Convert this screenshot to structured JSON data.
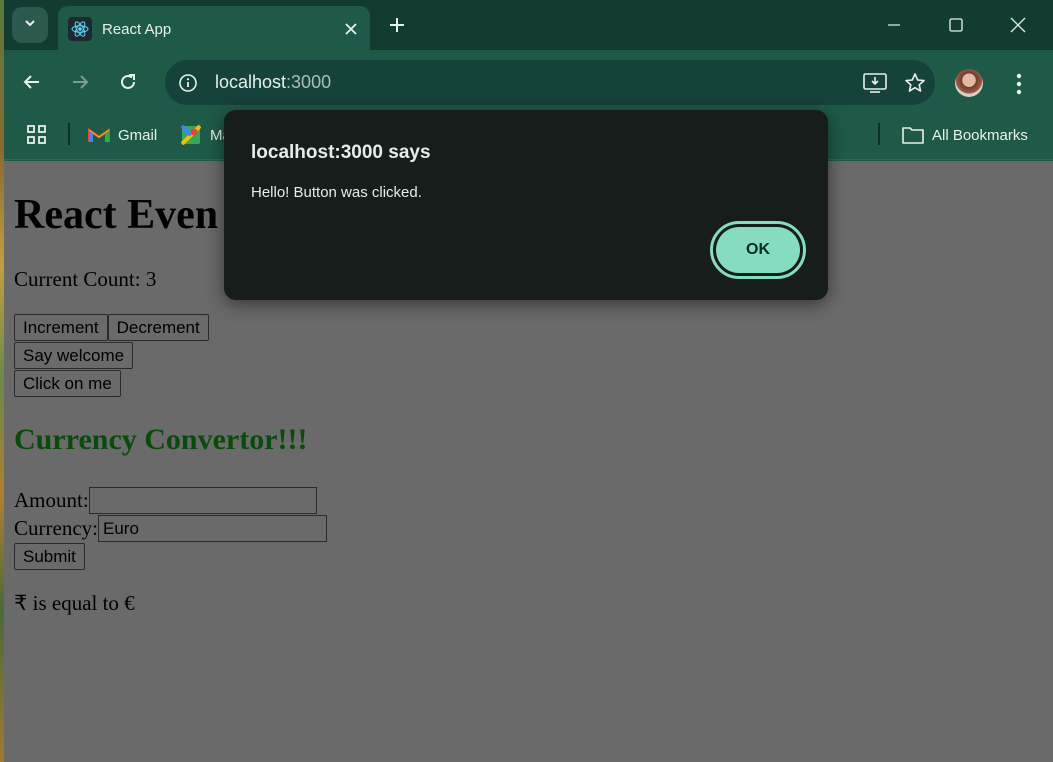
{
  "browser": {
    "tab_title": "React App",
    "url_host": "localhost",
    "url_port": ":3000",
    "bookmarks": [
      {
        "label": "Gmail"
      },
      {
        "label": "Ma"
      }
    ],
    "all_bookmarks_label": "All Bookmarks"
  },
  "page": {
    "heading": "React Even",
    "count_label": "Current Count: 3",
    "buttons": {
      "increment": "Increment",
      "decrement": "Decrement",
      "say_welcome": "Say welcome",
      "click_on_me": "Click on me"
    },
    "currency": {
      "heading": "Currency Convertor!!!",
      "amount_label": "Amount:",
      "amount_value": "",
      "currency_label": "Currency:",
      "currency_value": "Euro",
      "submit_label": "Submit",
      "result": "₹ is equal to €"
    }
  },
  "dialog": {
    "title": "localhost:3000 says",
    "message": "Hello! Button was clicked.",
    "ok_label": "OK"
  },
  "colors": {
    "browser_frame": "#1f5a48",
    "tab_strip": "#123c32",
    "page_overlay": "#6a6a6a",
    "dialog_bg": "#171d1b",
    "ok_button": "#86dcc1",
    "currency_heading": "#0a4a0a"
  }
}
